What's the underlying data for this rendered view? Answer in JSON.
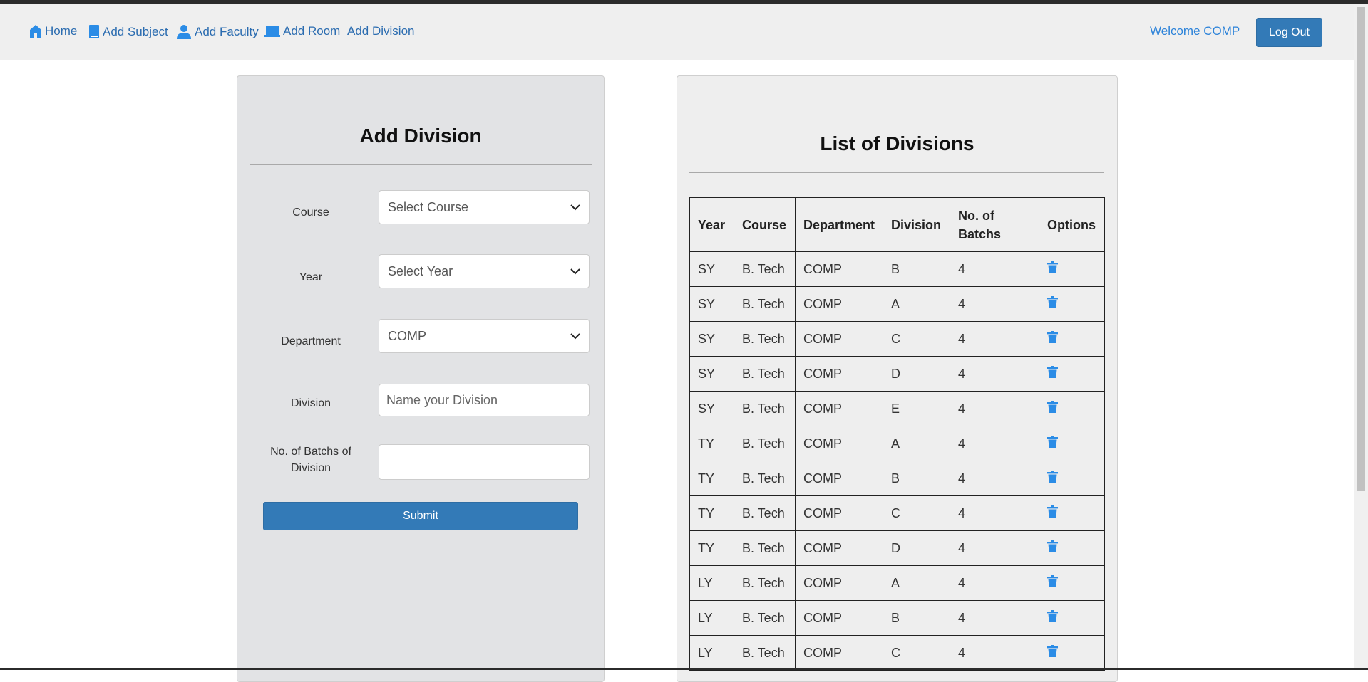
{
  "nav": {
    "items": [
      {
        "label": "Home",
        "icon": "home-icon"
      },
      {
        "label": "Add Subject",
        "icon": "book-icon"
      },
      {
        "label": "Add Faculty",
        "icon": "user-icon"
      },
      {
        "label": "Add Room",
        "icon": "laptop-icon"
      },
      {
        "label": "Add Division",
        "icon": ""
      }
    ],
    "welcome": "Welcome COMP",
    "logout_label": "Log Out"
  },
  "form": {
    "title": "Add Division",
    "course_label": "Course",
    "course_selected": "Select Course",
    "year_label": "Year",
    "year_selected": "Select Year",
    "department_label": "Department",
    "department_selected": "COMP",
    "division_label": "Division",
    "division_placeholder": "Name your Division",
    "batches_label_line1": "No. of Batchs of",
    "batches_label_line2": "Division",
    "batches_value": "",
    "submit_label": "Submit"
  },
  "list": {
    "title": "List of Divisions",
    "headers": [
      "Year",
      "Course",
      "Department",
      "Division",
      "No. of Batchs",
      "Options"
    ],
    "rows": [
      [
        "SY",
        "B. Tech",
        "COMP",
        "B",
        "4"
      ],
      [
        "SY",
        "B. Tech",
        "COMP",
        "A",
        "4"
      ],
      [
        "SY",
        "B. Tech",
        "COMP",
        "C",
        "4"
      ],
      [
        "SY",
        "B. Tech",
        "COMP",
        "D",
        "4"
      ],
      [
        "SY",
        "B. Tech",
        "COMP",
        "E",
        "4"
      ],
      [
        "TY",
        "B. Tech",
        "COMP",
        "A",
        "4"
      ],
      [
        "TY",
        "B. Tech",
        "COMP",
        "B",
        "4"
      ],
      [
        "TY",
        "B. Tech",
        "COMP",
        "C",
        "4"
      ],
      [
        "TY",
        "B. Tech",
        "COMP",
        "D",
        "4"
      ],
      [
        "LY",
        "B. Tech",
        "COMP",
        "A",
        "4"
      ],
      [
        "LY",
        "B. Tech",
        "COMP",
        "B",
        "4"
      ],
      [
        "LY",
        "B. Tech",
        "COMP",
        "C",
        "4"
      ]
    ],
    "delete_icon": "trash-icon"
  },
  "colors": {
    "link": "#2b6cb0",
    "primary_button": "#337ab7",
    "trash_icon": "#2b8ce6"
  }
}
